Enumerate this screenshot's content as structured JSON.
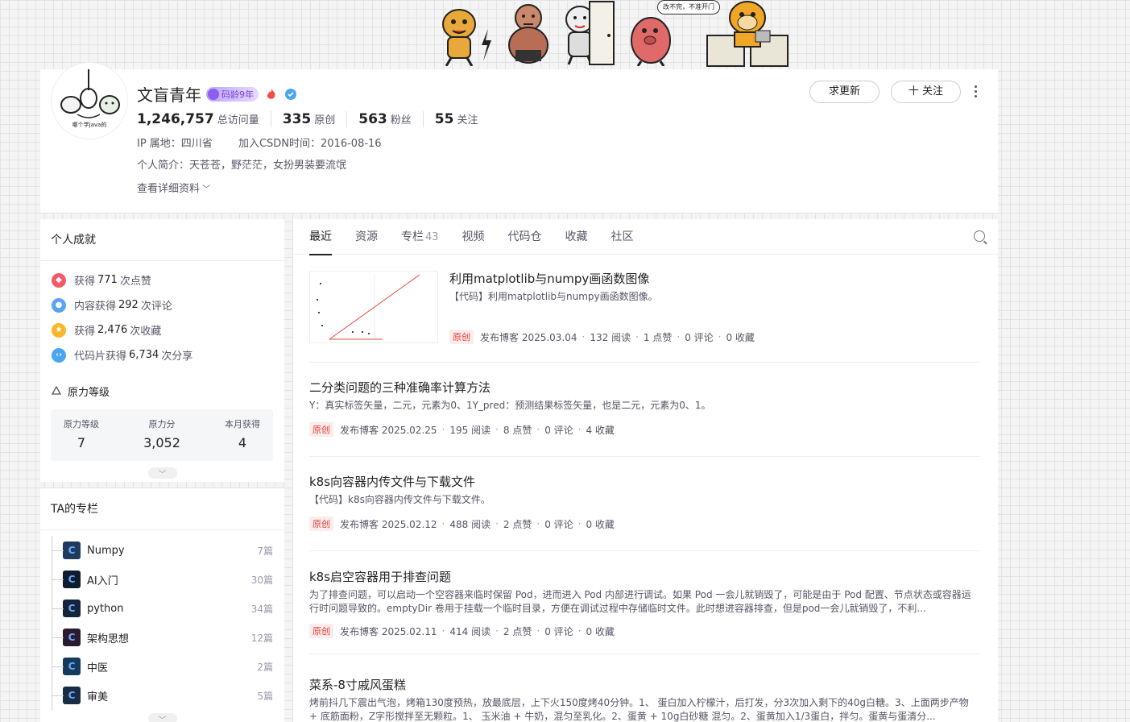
{
  "banner": {
    "bubble_text": "改不完，不准开门"
  },
  "profile": {
    "avatar_caption": "哪个学java的",
    "name": "文盲青年",
    "code_age": "码龄9年",
    "stats": [
      {
        "value": "1,246,757",
        "label": "总访问量"
      },
      {
        "value": "335",
        "label": "原创"
      },
      {
        "value": "563",
        "label": "粉丝"
      },
      {
        "value": "55",
        "label": "关注"
      }
    ],
    "ip_location": "IP 属地：四川省",
    "join_date": "加入CSDN时间：2016-08-16",
    "bio": "个人简介：天苍苍，野茫茫，女扮男装要流氓",
    "detail_link": "查看详细资料",
    "request_update_label": "求更新",
    "follow_label": "十 关注"
  },
  "achievements": {
    "title": "个人成就",
    "items": [
      {
        "prefix": "获得",
        "num": "771",
        "suffix": "次点赞",
        "color": "#f35a6a"
      },
      {
        "prefix": "内容获得",
        "num": "292",
        "suffix": "次评论",
        "color": "#5aa2f5"
      },
      {
        "prefix": "获得",
        "num": "2,476",
        "suffix": "次收藏",
        "color": "#f7b72d"
      },
      {
        "prefix": "代码片获得",
        "num": "6,734",
        "suffix": "次分享",
        "color": "#4aa6f0"
      }
    ],
    "level_title": "原力等级",
    "level": [
      {
        "label": "原力等级",
        "value": "7"
      },
      {
        "label": "原力分",
        "value": "3,052"
      },
      {
        "label": "本月获得",
        "value": "4"
      }
    ]
  },
  "columns": {
    "title": "TA的专栏",
    "items": [
      {
        "name": "Numpy",
        "count": "7篇",
        "bg": "#1e3a5f"
      },
      {
        "name": "AI入门",
        "count": "30篇",
        "bg": "#0f1b2e"
      },
      {
        "name": "python",
        "count": "34篇",
        "bg": "#16243b"
      },
      {
        "name": "架构思想",
        "count": "12篇",
        "bg": "#2a1b2e"
      },
      {
        "name": "中医",
        "count": "2篇",
        "bg": "#143c5a"
      },
      {
        "name": "审美",
        "count": "5篇",
        "bg": "#1a2b44"
      }
    ]
  },
  "tabs": [
    {
      "label": "最近",
      "sub": ""
    },
    {
      "label": "资源",
      "sub": ""
    },
    {
      "label": "专栏",
      "sub": "43"
    },
    {
      "label": "视频",
      "sub": ""
    },
    {
      "label": "代码仓",
      "sub": ""
    },
    {
      "label": "收藏",
      "sub": ""
    },
    {
      "label": "社区",
      "sub": ""
    }
  ],
  "articles": [
    {
      "title": "利用matplotlib与numpy画函数图像",
      "desc": "【代码】利用matplotlib与numpy画函数图像。",
      "tag": "原创",
      "date": "发布博客 2025.03.04",
      "reads": "132 阅读",
      "likes": "1 点赞",
      "comments": "0 评论",
      "favs": "0 收藏"
    },
    {
      "title": "二分类问题的三种准确率计算方法",
      "desc": "Y：真实标签矢量，二元，元素为0、1Y_pred：预测结果标签矢量，也是二元，元素为0、1。",
      "tag": "原创",
      "date": "发布博客 2025.02.25",
      "reads": "195 阅读",
      "likes": "8 点赞",
      "comments": "0 评论",
      "favs": "4 收藏"
    },
    {
      "title": "k8s向容器内传文件与下载文件",
      "desc": "【代码】k8s向容器内传文件与下载文件。",
      "tag": "原创",
      "date": "发布博客 2025.02.12",
      "reads": "488 阅读",
      "likes": "2 点赞",
      "comments": "0 评论",
      "favs": "0 收藏"
    },
    {
      "title": "k8s启空容器用于排查问题",
      "desc": "为了排查问题，可以启动一个空容器来临时保留 Pod，进而进入 Pod 内部进行调试。如果 Pod 一会儿就销毁了，可能是由于 Pod 配置、节点状态或容器运行时问题导致的。emptyDir 卷用于挂载一个临时目录，方便在调试过程中存储临时文件。此时想进容器排查，但是pod一会儿就销毁了，不利...",
      "tag": "原创",
      "date": "发布博客 2025.02.11",
      "reads": "414 阅读",
      "likes": "2 点赞",
      "comments": "0 评论",
      "favs": "0 收藏"
    },
    {
      "title": "菜系-8寸戚风蛋糕",
      "desc": "烤前抖几下震出气泡，烤箱130度预热，放最底层，上下火150度烤40分钟。1、 蛋白加入柠檬汁，后打发，分3次加入剩下的40g白糖。3、上面两步产物 + 底筋面粉，Z字形搅拌至无颗粒。1、 玉米油 + 牛奶，混匀至乳化。2、蛋黄 + 10g白砂糖 混匀。2、蛋黄加入1/3蛋白，拌匀。蛋黄与蛋清分...",
      "tag": "",
      "date": "",
      "reads": "",
      "likes": "",
      "comments": "",
      "favs": ""
    }
  ]
}
